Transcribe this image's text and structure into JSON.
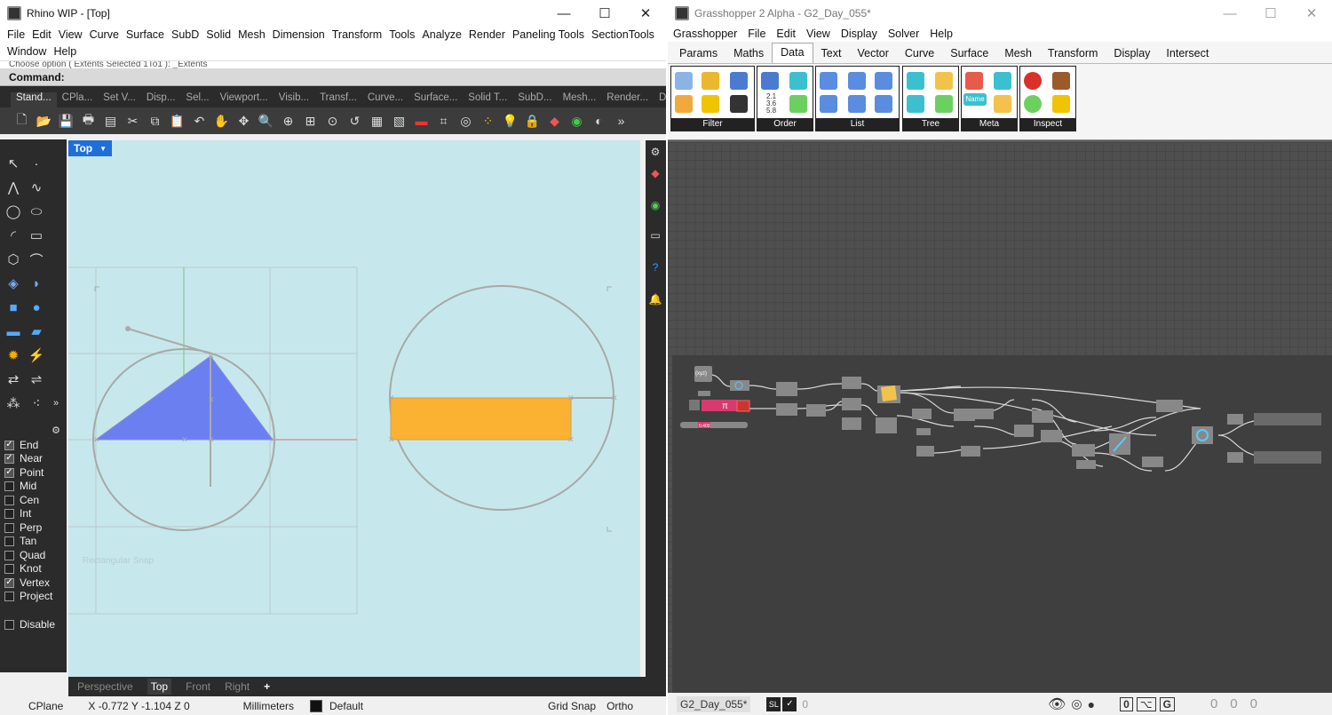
{
  "rhino": {
    "title": "Rhino WIP - [Top]",
    "menu": [
      "File",
      "Edit",
      "View",
      "Curve",
      "Surface",
      "SubD",
      "Solid",
      "Mesh",
      "Dimension",
      "Transform",
      "Tools",
      "Analyze",
      "Render",
      "Paneling Tools",
      "SectionTools",
      "Window",
      "Help"
    ],
    "command_history": "Choose option ( Extents  Selected  1To1 ): _Extents",
    "command_prompt": "Command:",
    "toolbar_tabs": [
      "Stand...",
      "CPla...",
      "Set V...",
      "Disp...",
      "Sel...",
      "Viewport...",
      "Visib...",
      "Transf...",
      "Curve...",
      "Surface...",
      "Solid T...",
      "SubD...",
      "Mesh...",
      "Render...",
      "Draft..."
    ],
    "viewport_name": "Top",
    "viewport_tabs": [
      "Perspective",
      "Top",
      "Front",
      "Right",
      "+"
    ],
    "osnaps": [
      {
        "label": "End",
        "checked": true
      },
      {
        "label": "Near",
        "checked": true
      },
      {
        "label": "Point",
        "checked": true
      },
      {
        "label": "Mid",
        "checked": false
      },
      {
        "label": "Cen",
        "checked": false
      },
      {
        "label": "Int",
        "checked": false
      },
      {
        "label": "Perp",
        "checked": false
      },
      {
        "label": "Tan",
        "checked": false
      },
      {
        "label": "Quad",
        "checked": false
      },
      {
        "label": "Knot",
        "checked": false
      },
      {
        "label": "Vertex",
        "checked": true
      },
      {
        "label": "Project",
        "checked": false
      }
    ],
    "disable_label": "Disable",
    "status": {
      "cplane": "CPlane",
      "coords": "X -0.772  Y -1.104  Z 0",
      "units": "Millimeters",
      "layer": "Default",
      "grid_snap": "Grid Snap",
      "ortho": "Ortho"
    },
    "faint_text": "Rectangular Snap"
  },
  "grasshopper": {
    "title": "Grasshopper 2 Alpha - G2_Day_055*",
    "menu": [
      "Grasshopper",
      "File",
      "Edit",
      "View",
      "Display",
      "Solver",
      "Help"
    ],
    "tabs": [
      "Params",
      "Maths",
      "Data",
      "Text",
      "Vector",
      "Curve",
      "Surface",
      "Mesh",
      "Transform",
      "Display",
      "Intersect"
    ],
    "active_tab": "Data",
    "panels": [
      "Filter",
      "Order",
      "List",
      "Tree",
      "Meta",
      "Inspect"
    ],
    "order_numbers": [
      "2.1",
      "3.6",
      "5.8"
    ],
    "meta_name": "Name",
    "xyz_label": "{xyz}",
    "pi_label": "π",
    "slider_value": "0.400",
    "doc_tab": "G2_Day_055*",
    "status_counter": "0",
    "status_right": [
      "0",
      "0",
      "0"
    ]
  },
  "colors": {
    "triangle": "#6b7ff0",
    "rectangle": "#fbb232",
    "viewport_bg": "#c6e8ec",
    "active_view": "#1f6fd8",
    "pi_node": "#d63a6e"
  }
}
